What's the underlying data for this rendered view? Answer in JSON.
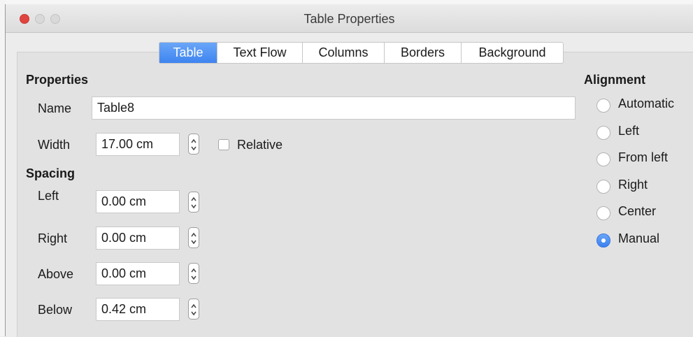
{
  "window": {
    "title": "Table Properties"
  },
  "tabs": [
    {
      "label": "Table",
      "active": true
    },
    {
      "label": "Text Flow",
      "active": false
    },
    {
      "label": "Columns",
      "active": false
    },
    {
      "label": "Borders",
      "active": false
    },
    {
      "label": "Background",
      "active": false
    }
  ],
  "properties": {
    "heading": "Properties",
    "name_label": "Name",
    "name_value": "Table8",
    "width_label": "Width",
    "width_value": "17.00 cm",
    "relative_label": "Relative",
    "relative_checked": false
  },
  "spacing": {
    "heading": "Spacing",
    "left_label": "Left",
    "left_value": "0.00 cm",
    "right_label": "Right",
    "right_value": "0.00 cm",
    "above_label": "Above",
    "above_value": "0.00 cm",
    "below_label": "Below",
    "below_value": "0.42 cm"
  },
  "alignment": {
    "heading": "Alignment",
    "options": [
      "Automatic",
      "Left",
      "From left",
      "Right",
      "Center",
      "Manual"
    ],
    "selected": "Manual"
  },
  "colors": {
    "accent": "#3e84f0",
    "close_button": "#e0443e"
  },
  "icons": [
    "stepper-icon",
    "radio-selected-icon"
  ]
}
